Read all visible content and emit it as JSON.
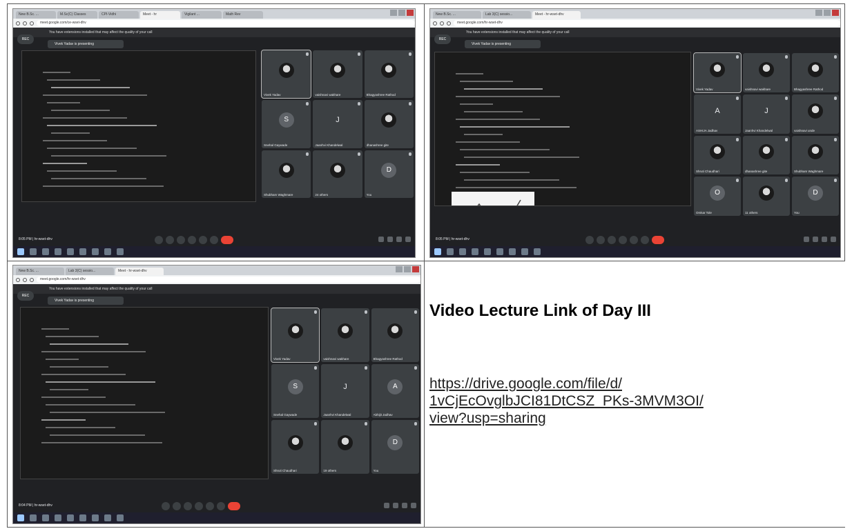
{
  "caption": {
    "heading": "Video Lecture Link of Day III",
    "link_lines": [
      "https://drive.google.com/file/d/",
      "1vCjEcOvglbJCI81DtCSZ_PKs-3MVM3OI/",
      "view?usp=sharing"
    ]
  },
  "screenshots": [
    {
      "tabs": [
        "New B.Sc. ...",
        "M.Sc(C) Classes",
        "CPI-Vidhi",
        "Meet - hr",
        "Vigilant ...",
        "Math Rev"
      ],
      "url": "meet.google.com/ce-wset-dhv",
      "banner": "You have extensions installed that may affect the quality of your call",
      "rec_label": "REC",
      "presenting": "Vivek Yadav is presenting",
      "participants": [
        {
          "name": "Vivek Yadav",
          "initial": "",
          "style": "photo"
        },
        {
          "name": "vaishnavi wakhare",
          "initial": "",
          "style": "photo"
        },
        {
          "name": "Bhagyashree Rathod",
          "initial": "",
          "style": "photo"
        },
        {
          "name": "Snehal Gaywade",
          "initial": "S",
          "style": "letter"
        },
        {
          "name": "Jaanhvi Khandelwal",
          "initial": "J",
          "style": "plain"
        },
        {
          "name": "dhanashree gite",
          "initial": "",
          "style": "photo"
        },
        {
          "name": "Shubham Waghmare",
          "initial": "",
          "style": "photo"
        },
        {
          "name": "24 others",
          "initial": "",
          "style": "photo"
        },
        {
          "name": "You",
          "initial": "D",
          "style": "letter"
        }
      ],
      "clock": "8:05 PM | hr-wset-dhv"
    },
    {
      "tabs": [
        "New B.Sc. ...",
        "Lab 3(C) sessio...",
        "Meet - hr-wset-dhv"
      ],
      "url": "meet.google.com/hr-wset-dhv",
      "banner": "You have extensions installed that may affect the quality of your call",
      "rec_label": "REC",
      "presenting": "Vivek Yadav is presenting",
      "participants": [
        {
          "name": "Vivek Yadav",
          "initial": "",
          "style": "photo"
        },
        {
          "name": "vaishnavi wakhare",
          "initial": "",
          "style": "photo"
        },
        {
          "name": "Bhagyashree Rathod",
          "initial": "",
          "style": "photo"
        },
        {
          "name": "ASHIJA Jadhav",
          "initial": "A",
          "style": "plain"
        },
        {
          "name": "Jaanhvi Khandelwal",
          "initial": "J",
          "style": "plain"
        },
        {
          "name": "vaishnavi unde",
          "initial": "",
          "style": "photo"
        },
        {
          "name": "Shruti Chaudhari",
          "initial": "",
          "style": "photo"
        },
        {
          "name": "dhanashree gite",
          "initial": "",
          "style": "photo"
        },
        {
          "name": "Shubham Waghmare",
          "initial": "",
          "style": "photo"
        },
        {
          "name": "Omkar Tole",
          "initial": "O",
          "style": "letter"
        },
        {
          "name": "11 others",
          "initial": "",
          "style": "photo"
        },
        {
          "name": "You",
          "initial": "D",
          "style": "letter"
        }
      ],
      "clock": "8:05 PM | hr-wset-dhv"
    },
    {
      "tabs": [
        "New B.Sc. ...",
        "Lab 3(C) sessio...",
        "Meet - hr-wset-dhv"
      ],
      "url": "meet.google.com/hr-wset-dhv",
      "banner": "You have extensions installed that may affect the quality of your call",
      "rec_label": "REC",
      "presenting": "Vivek Yadav is presenting",
      "participants": [
        {
          "name": "Vivek Yadav",
          "initial": "",
          "style": "photo"
        },
        {
          "name": "vaishnavi wakhare",
          "initial": "",
          "style": "photo"
        },
        {
          "name": "Bhagyashree Rathod",
          "initial": "",
          "style": "photo"
        },
        {
          "name": "Snehal Gaywade",
          "initial": "S",
          "style": "letter"
        },
        {
          "name": "Jaanhvi Khandelwal",
          "initial": "J",
          "style": "plain"
        },
        {
          "name": "Abhijit Jadhav",
          "initial": "A",
          "style": "letter"
        },
        {
          "name": "Shruti Chaudhari",
          "initial": "",
          "style": "photo"
        },
        {
          "name": "19 others",
          "initial": "",
          "style": "photo"
        },
        {
          "name": "You",
          "initial": "D",
          "style": "letter"
        }
      ],
      "clock": "8:04 PM | hr-wset-dhv"
    }
  ]
}
